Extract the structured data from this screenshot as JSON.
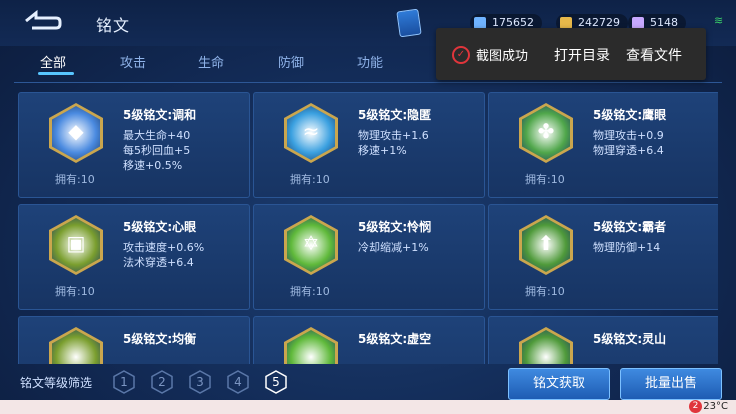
{
  "header": {
    "title": "铭文"
  },
  "resources": [
    {
      "value": "175652",
      "icon": "diamond-icon",
      "color": "#6fb3ff"
    },
    {
      "value": "242729",
      "icon": "gold-coin-icon",
      "color": "#e7b84a"
    },
    {
      "value": "5148",
      "icon": "crystal-icon",
      "color": "#c7a8ff"
    }
  ],
  "tabs": [
    "全部",
    "攻击",
    "生命",
    "防御",
    "功能"
  ],
  "active_tab": 0,
  "toast": {
    "message": "截图成功",
    "open_dir": "打开目录",
    "view_file": "查看文件"
  },
  "inscriptions": [
    {
      "name": "5级铭文:调和",
      "attrs": [
        "最大生命+40",
        "每5秒回血+5",
        "移速+0.5%"
      ],
      "owned": "拥有:10",
      "color": "#4a8ae0",
      "glyph": "◆"
    },
    {
      "name": "5级铭文:隐匿",
      "attrs": [
        "物理攻击+1.6",
        "移速+1%"
      ],
      "owned": "拥有:10",
      "color": "#3aa0e0",
      "glyph": "≈"
    },
    {
      "name": "5级铭文:鹰眼",
      "attrs": [
        "物理攻击+0.9",
        "物理穿透+6.4"
      ],
      "owned": "拥有:10",
      "color": "#4fa64a",
      "glyph": "✤"
    },
    {
      "name": "5级铭文:心眼",
      "attrs": [
        "攻击速度+0.6%",
        "法术穿透+6.4"
      ],
      "owned": "拥有:10",
      "color": "#7a9e2e",
      "glyph": "▣"
    },
    {
      "name": "5级铭文:怜悯",
      "attrs": [
        "冷却缩减+1%"
      ],
      "owned": "拥有:10",
      "color": "#5fb93a",
      "glyph": "✡"
    },
    {
      "name": "5级铭文:霸者",
      "attrs": [
        "物理防御+14"
      ],
      "owned": "拥有:10",
      "color": "#4f9a3a",
      "glyph": "⬆"
    },
    {
      "name": "5级铭文:均衡",
      "attrs": [],
      "owned": "",
      "color": "#7a9e2e",
      "glyph": ""
    },
    {
      "name": "5级铭文:虚空",
      "attrs": [],
      "owned": "",
      "color": "#5fb93a",
      "glyph": ""
    },
    {
      "name": "5级铭文:灵山",
      "attrs": [],
      "owned": "",
      "color": "#4f9a3a",
      "glyph": ""
    }
  ],
  "filter": {
    "label": "铭文等级筛选",
    "levels": [
      "1",
      "2",
      "3",
      "4",
      "5"
    ],
    "selected": 4
  },
  "buttons": {
    "acquire": "铭文获取",
    "bulk_sell": "批量出售"
  },
  "taskbar": {
    "notifications": "2",
    "temperature": "23°C"
  }
}
